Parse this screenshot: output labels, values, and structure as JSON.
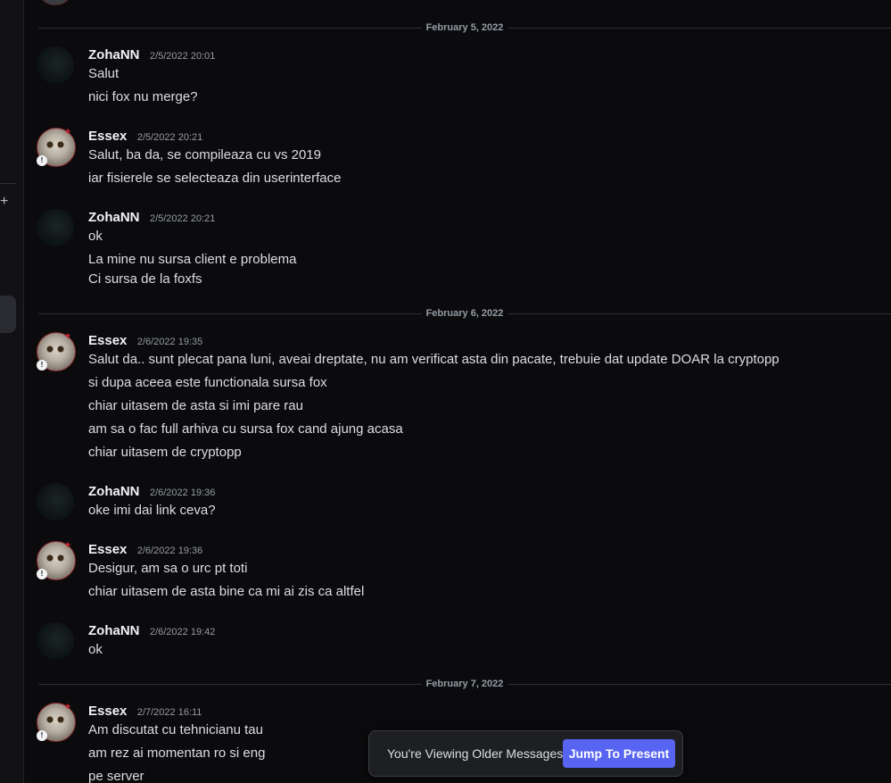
{
  "sidebar": {
    "plus_icon": "+"
  },
  "date_separators": [
    "February 5, 2022",
    "February 6, 2022",
    "February 7, 2022"
  ],
  "messages": [
    {
      "author": "ZohaNN",
      "time": "2/5/2022 20:01",
      "lines": [
        "Salut",
        "nici fox nu merge?"
      ]
    },
    {
      "author": "Essex",
      "time": "2/5/2022 20:21",
      "lines": [
        "Salut, ba da, se compileaza cu vs 2019",
        "iar fisierele se selecteaza din userinterface"
      ]
    },
    {
      "author": "ZohaNN",
      "time": "2/5/2022 20:21",
      "lines": [
        "ok",
        "La mine nu sursa client e problema",
        "Ci sursa de la foxfs"
      ]
    },
    {
      "author": "Essex",
      "time": "2/6/2022 19:35",
      "lines": [
        "Salut da.. sunt plecat pana luni, aveai dreptate, nu am verificat asta din pacate, trebuie dat update DOAR la cryptopp",
        "si dupa aceea este functionala sursa fox",
        "chiar uitasem de asta si imi pare rau",
        "am sa o fac full arhiva cu sursa fox cand ajung acasa",
        "chiar uitasem de cryptopp"
      ]
    },
    {
      "author": "ZohaNN",
      "time": "2/6/2022 19:36",
      "lines": [
        "oke imi dai link ceva?"
      ]
    },
    {
      "author": "Essex",
      "time": "2/6/2022 19:36",
      "lines": [
        "Desigur, am sa o urc pt toti",
        "chiar uitasem de asta bine ca mi ai zis ca altfel"
      ]
    },
    {
      "author": "ZohaNN",
      "time": "2/6/2022 19:42",
      "lines": [
        "ok"
      ]
    },
    {
      "author": "Essex",
      "time": "2/7/2022 16:11",
      "lines": [
        "Am discutat cu tehnicianu tau",
        "am rez ai momentan ro si eng",
        "pe server"
      ]
    }
  ],
  "jump_bar": {
    "text": "You're Viewing Older Messages",
    "button": "Jump To Present"
  },
  "colors": {
    "accent": "#5865f2",
    "background": "#0b0b0d",
    "username": "#f2f3f5",
    "timestamp": "#949ba4"
  }
}
